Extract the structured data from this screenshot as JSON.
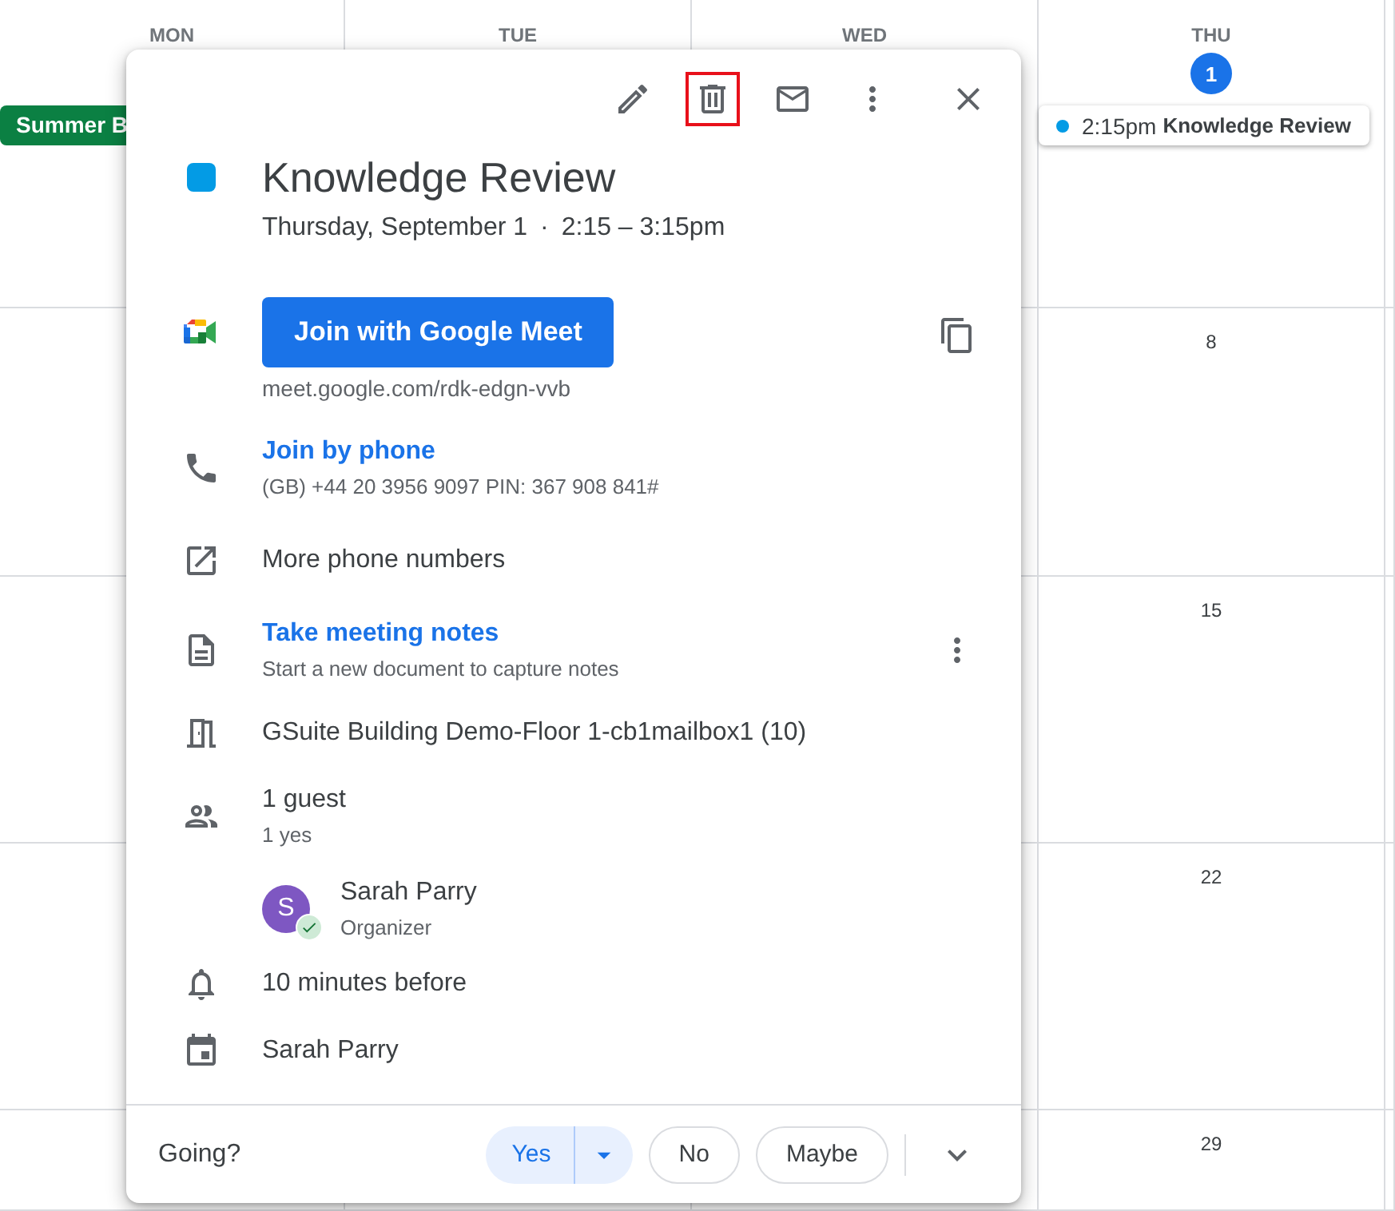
{
  "calendar": {
    "columns": [
      {
        "day": "MON"
      },
      {
        "day": "TUE"
      },
      {
        "day": "WED"
      },
      {
        "day": "THU",
        "date": "1",
        "today": true
      }
    ],
    "banner_event": {
      "title": "Summer B",
      "color": "#0b8043"
    },
    "event_chip": {
      "time": "2:15pm",
      "title": "Knowledge Review",
      "color": "#039be5"
    },
    "thu_dates": [
      "8",
      "15",
      "22",
      "29"
    ]
  },
  "popup": {
    "toolbar": [
      {
        "kind": "edit",
        "highlighted": false
      },
      {
        "kind": "delete",
        "highlighted": true
      },
      {
        "kind": "email",
        "highlighted": false
      },
      {
        "kind": "more",
        "highlighted": false
      },
      {
        "kind": "close",
        "highlighted": false
      }
    ],
    "event": {
      "title": "Knowledge Review",
      "color": "#039be5",
      "date": "Thursday, September 1",
      "separator": "·",
      "time": "2:15 – 3:15pm"
    },
    "meet": {
      "button": "Join with Google Meet",
      "link": "meet.google.com/rdk-edgn-vvb"
    },
    "rows": [
      {
        "kind": "phone",
        "title": "Join by phone",
        "subtitle": "(GB) +44 20 3956 9097 PIN: 367 908 841#"
      },
      {
        "kind": "external",
        "title": "More phone numbers"
      },
      {
        "kind": "notes",
        "title": "Take meeting notes",
        "subtitle": "Start a new document to capture notes"
      },
      {
        "kind": "room",
        "title": "GSuite Building Demo-Floor 1-cb1mailbox1 (10)"
      },
      {
        "kind": "guests",
        "title": "1 guest",
        "subtitle": "1 yes"
      },
      {
        "kind": "guest",
        "title": "Sarah Parry",
        "subtitle": "Organizer",
        "initial": "S",
        "color": "#7e57c2",
        "accepted": true
      },
      {
        "kind": "reminder",
        "title": "10 minutes before"
      },
      {
        "kind": "calendar",
        "title": "Sarah Parry"
      }
    ],
    "rsvp": {
      "label": "Going?",
      "options": [
        {
          "label": "Yes",
          "selected": true
        },
        {
          "label": "No",
          "selected": false
        },
        {
          "label": "Maybe",
          "selected": false
        }
      ]
    }
  }
}
